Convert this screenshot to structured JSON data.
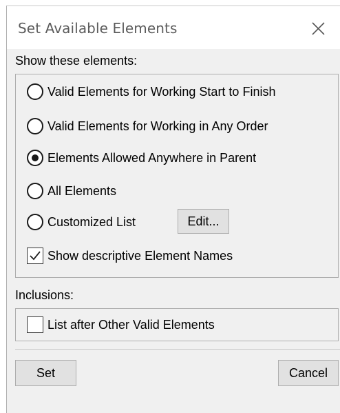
{
  "dialog": {
    "title": "Set Available Elements",
    "close_icon": "close-icon"
  },
  "show_section": {
    "label": "Show these elements:",
    "options": [
      {
        "label": "Valid Elements for Working Start to Finish",
        "selected": false
      },
      {
        "label": "Valid Elements for Working in Any Order",
        "selected": false
      },
      {
        "label": "Elements Allowed Anywhere in Parent",
        "selected": true
      },
      {
        "label": "All Elements",
        "selected": false
      },
      {
        "label": "Customized List",
        "selected": false
      }
    ],
    "edit_button_label": "Edit...",
    "descriptive_names": {
      "label": "Show descriptive Element Names",
      "checked": true
    }
  },
  "inclusions_section": {
    "label": "Inclusions:",
    "list_after": {
      "label": "List after Other Valid Elements",
      "checked": false
    }
  },
  "footer": {
    "set_label": "Set",
    "cancel_label": "Cancel"
  }
}
